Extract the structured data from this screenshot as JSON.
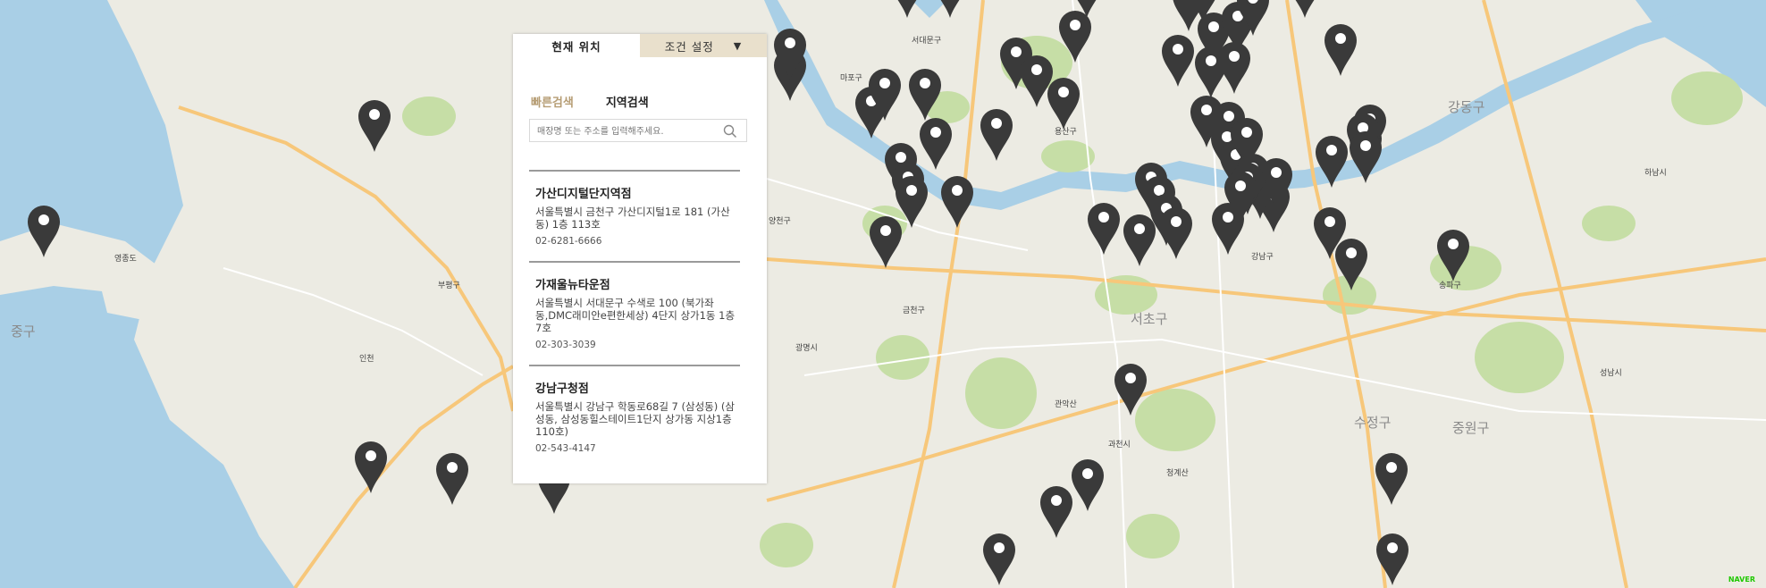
{
  "tabs": [
    {
      "label": "현재 위치"
    },
    {
      "label": "조건 설정",
      "arrow": "▼"
    }
  ],
  "subtabs": [
    {
      "label": "빠른검색"
    },
    {
      "label": "지역검색"
    }
  ],
  "search": {
    "placeholder": "매장명 또는 주소를 입력해주세요."
  },
  "stores": [
    {
      "name": "가산디지털단지역점",
      "address": "서울특별시 금천구 가산디지털1로 181 (가산동) 1층 113호",
      "phone": "02-6281-6666"
    },
    {
      "name": "가재울뉴타운점",
      "address": "서울특별시 서대문구 수색로 100 (북가좌동,DMC래미안e편한세상) 4단지 상가1동 1층 7호",
      "phone": "02-303-3039"
    },
    {
      "name": "강남구청점",
      "address": "서울특별시 강남구 학동로68길 7 (삼성동) (삼성동, 삼성동힐스테이트1단지 상가동 지상1층 110호)",
      "phone": "02-543-4147"
    }
  ],
  "map_labels": {
    "districts": [
      "강동구",
      "서초구",
      "수정구",
      "중원구",
      "중구"
    ],
    "places": [
      "영종도",
      "인천",
      "부평구",
      "서대문구",
      "마포구",
      "용산구",
      "광명시",
      "과천시",
      "하남시",
      "성남시",
      "송파구",
      "강남구",
      "양천구",
      "금천구",
      "관악산",
      "청계산"
    ]
  },
  "brand": "NAVER",
  "colors": {
    "water": "#a9cfe6",
    "land": "#ecebe3",
    "park": "#c6dea6",
    "road": "#f7c77a",
    "tab_inactive": "#e9e0cc",
    "subtab_accent": "#b69d74",
    "pin": "#3a3a3a"
  }
}
